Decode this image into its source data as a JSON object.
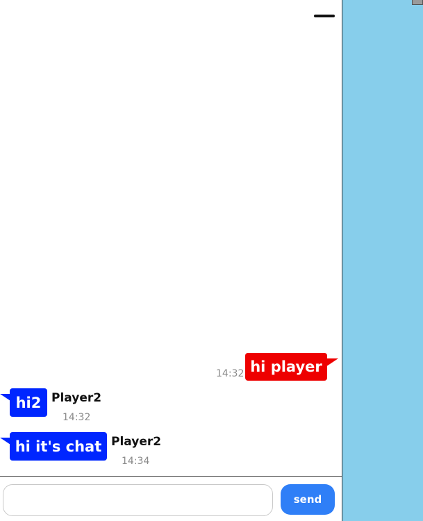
{
  "chat": {
    "messages": [
      {
        "text": "hi player",
        "time": "14:32",
        "sender": "",
        "own": true
      },
      {
        "text": "hi2",
        "time": "14:32",
        "sender": "Player2",
        "own": false
      },
      {
        "text": "hi it's chat",
        "time": "14:34",
        "sender": "Player2",
        "own": false
      }
    ]
  },
  "input": {
    "value": "",
    "placeholder": ""
  },
  "send_label": "send",
  "colors": {
    "own_bubble": "#ee0000",
    "other_bubble": "#0026ff",
    "send_button": "#2f7ff7",
    "game_background": "#87ceeb"
  },
  "icons": {
    "minimize": "minus-icon"
  }
}
